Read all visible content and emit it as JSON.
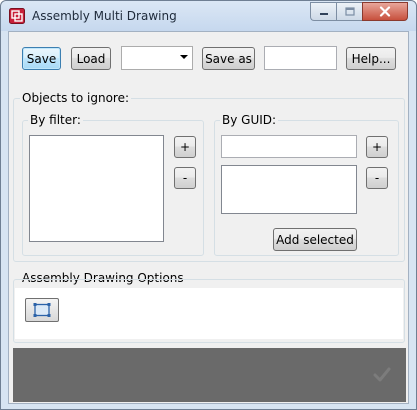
{
  "window": {
    "title": "Assembly Multi Drawing",
    "icons": {
      "app": "assembly-drawing-app-icon",
      "minimize": "minimize-icon",
      "maximize": "maximize-icon",
      "close": "close-icon"
    }
  },
  "toolbar": {
    "save_label": "Save",
    "load_label": "Load",
    "preset_select_value": "",
    "save_as_label": "Save as",
    "save_as_value": "",
    "help_label": "Help..."
  },
  "ignore": {
    "title": "Objects to ignore:",
    "by_filter": {
      "label": "By filter:",
      "add_label": "+",
      "remove_label": "-",
      "items": []
    },
    "by_guid": {
      "label": "By GUID:",
      "input_value": "",
      "add_label": "+",
      "remove_label": "-",
      "items": [],
      "add_selected_label": "Add selected"
    }
  },
  "options": {
    "title": "Assembly Drawing Options",
    "icons": {
      "edit_options": "selection-frame-icon"
    }
  },
  "footer": {
    "icons": {
      "apply": "checkmark-icon"
    }
  },
  "colors": {
    "footer_bg": "#6a6a6a",
    "window_frame": "#d7e4f2",
    "close_button": "#c7503d"
  }
}
